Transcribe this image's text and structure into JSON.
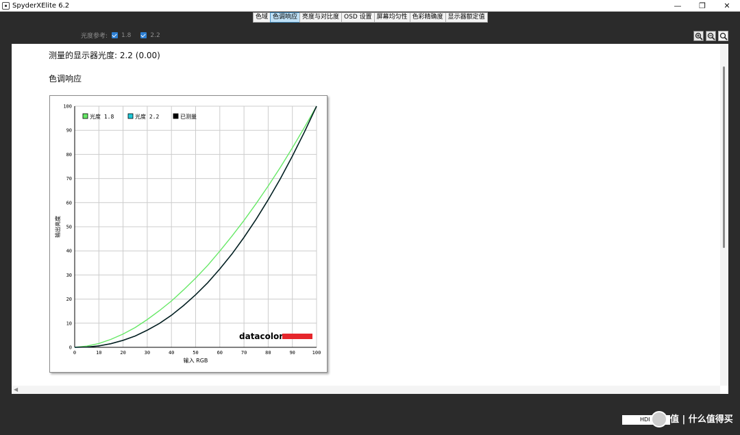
{
  "window": {
    "title": "SpyderXElite 6.2"
  },
  "tabs": [
    {
      "label": "色域",
      "active": false
    },
    {
      "label": "色调响应",
      "active": true
    },
    {
      "label": "亮度与对比度",
      "active": false
    },
    {
      "label": "OSD 设置",
      "active": false
    },
    {
      "label": "屏幕均匀性",
      "active": false
    },
    {
      "label": "色彩精确度",
      "active": false
    },
    {
      "label": "显示器额定值",
      "active": false
    }
  ],
  "gamma_ref": {
    "label": "光度参考:",
    "opt1": "1.8",
    "opt2": "2.2",
    "checked1": true,
    "checked2": true
  },
  "measured": {
    "text": "测量的显示器光度: 2.2 (0.00)"
  },
  "section_title": "色调响应",
  "footer": {
    "label": "HDI"
  },
  "watermark": {
    "text": "值 | 什么值得买"
  },
  "colors": {
    "gamma18": "#66e866",
    "gamma22": "#1ec8d8",
    "measured": "#000000",
    "grid": "#cccccc",
    "brand": "#e5262b"
  },
  "chart_data": {
    "type": "line",
    "title": "",
    "xlabel": "输入 RGB",
    "ylabel": "输出亮度",
    "xlim": [
      0,
      100
    ],
    "ylim": [
      0,
      100
    ],
    "xticks": [
      0,
      10,
      20,
      30,
      40,
      50,
      60,
      70,
      80,
      90,
      100
    ],
    "yticks": [
      0,
      10,
      20,
      30,
      40,
      50,
      60,
      70,
      80,
      90,
      100
    ],
    "grid": true,
    "legend_position": "top-left",
    "brand": "datacolor",
    "x": [
      0,
      5,
      10,
      15,
      20,
      25,
      30,
      35,
      40,
      45,
      50,
      55,
      60,
      65,
      70,
      75,
      80,
      85,
      90,
      95,
      100
    ],
    "series": [
      {
        "name": "光度 1.8",
        "color": "#66e866",
        "values": [
          0,
          0.5,
          1.6,
          3.3,
          5.5,
          8.2,
          11.5,
          15.2,
          19.2,
          23.8,
          28.7,
          34.0,
          39.9,
          46.1,
          52.6,
          59.6,
          66.9,
          74.6,
          82.7,
          91.2,
          100
        ]
      },
      {
        "name": "光度 2.2",
        "color": "#1ec8d8",
        "values": [
          0,
          0.1,
          0.6,
          1.5,
          2.9,
          4.7,
          7.1,
          9.9,
          13.3,
          17.3,
          21.8,
          26.8,
          32.5,
          38.7,
          45.6,
          53.1,
          61.2,
          69.9,
          79.3,
          89.3,
          100
        ]
      },
      {
        "name": "已测量",
        "color": "#000000",
        "values": [
          0,
          0.1,
          0.6,
          1.5,
          2.9,
          4.7,
          7.1,
          9.9,
          13.3,
          17.3,
          21.8,
          26.8,
          32.5,
          38.7,
          45.6,
          53.1,
          61.2,
          69.9,
          79.3,
          89.3,
          100
        ]
      }
    ]
  }
}
